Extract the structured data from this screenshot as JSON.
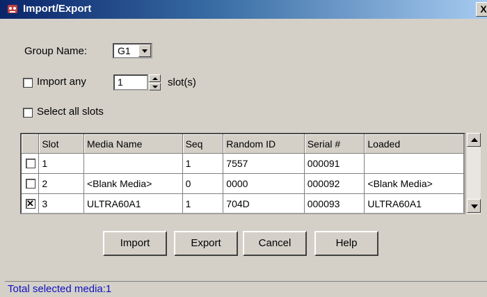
{
  "window": {
    "title": "Import/Export",
    "close_label": "X"
  },
  "group": {
    "label": "Group Name:",
    "value": "G1"
  },
  "import_any": {
    "label": "Import any",
    "checked": false,
    "value": "1",
    "suffix": "slot(s)"
  },
  "select_all": {
    "label": "Select all slots",
    "checked": false
  },
  "table": {
    "headers": [
      "",
      "Slot",
      "Media Name",
      "Seq",
      "Random ID",
      "Serial #",
      "Loaded"
    ],
    "rows": [
      {
        "checked": false,
        "slot": "1",
        "media": "",
        "seq": "1",
        "random_id": "7557",
        "serial": "000091",
        "loaded": ""
      },
      {
        "checked": false,
        "slot": "2",
        "media": "<Blank Media>",
        "seq": "0",
        "random_id": "0000",
        "serial": "000092",
        "loaded": "<Blank Media>"
      },
      {
        "checked": true,
        "slot": "3",
        "media": "ULTRA60A1",
        "seq": "1",
        "random_id": "704D",
        "serial": "000093",
        "loaded": "ULTRA60A1"
      }
    ]
  },
  "buttons": {
    "import": "Import",
    "export": "Export",
    "cancel": "Cancel",
    "help": "Help"
  },
  "status": {
    "text": "Total selected media:1"
  },
  "colors": {
    "title_bar": "#0a246a",
    "status_text": "#1010c0",
    "window_bg": "#d4d0c8"
  }
}
